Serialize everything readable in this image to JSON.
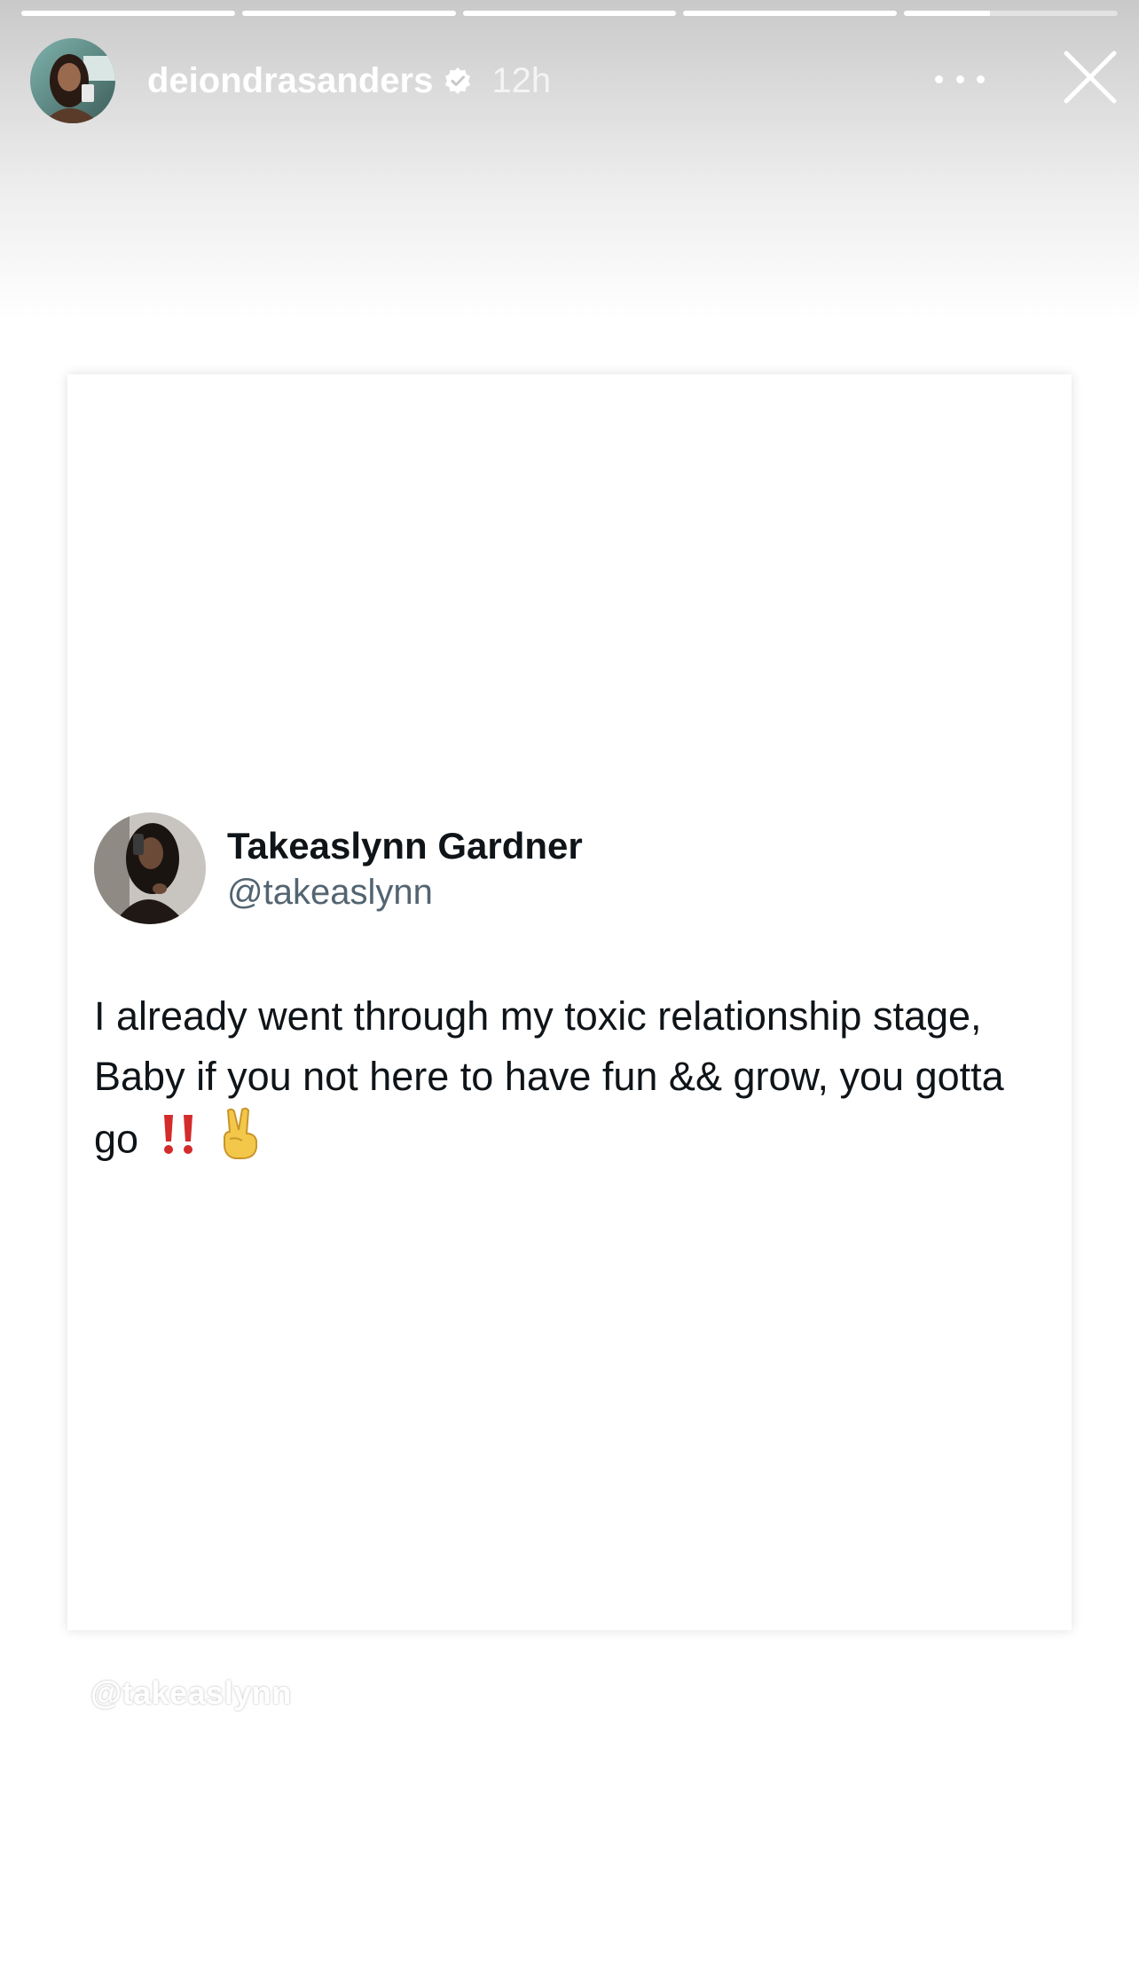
{
  "story": {
    "progress_segments": [
      {
        "fill": 1.0
      },
      {
        "fill": 1.0
      },
      {
        "fill": 1.0
      },
      {
        "fill": 1.0
      },
      {
        "fill": 0.4
      }
    ],
    "header": {
      "username": "deiondrasanders",
      "verified_icon": "verified-badge-icon",
      "time": "12h",
      "more_icon": "more-horizontal-icon",
      "close_icon": "close-icon"
    }
  },
  "tweet": {
    "display_name": "Takeaslynn Gardner",
    "handle": "@takeaslynn",
    "text": "I already went through my toxic relationship stage, Baby if you not here to have fun && grow, you gotta go",
    "emojis": [
      "double-exclamation-icon",
      "victory-hand-icon"
    ]
  },
  "mention_sticker": {
    "text": "@takeaslynn"
  },
  "colors": {
    "text_primary": "#0f1419",
    "text_secondary": "#536471",
    "overlay_text": "#ffffff",
    "exclamation_red": "#d42b2b",
    "emoji_yellow": "#f3c84a"
  }
}
